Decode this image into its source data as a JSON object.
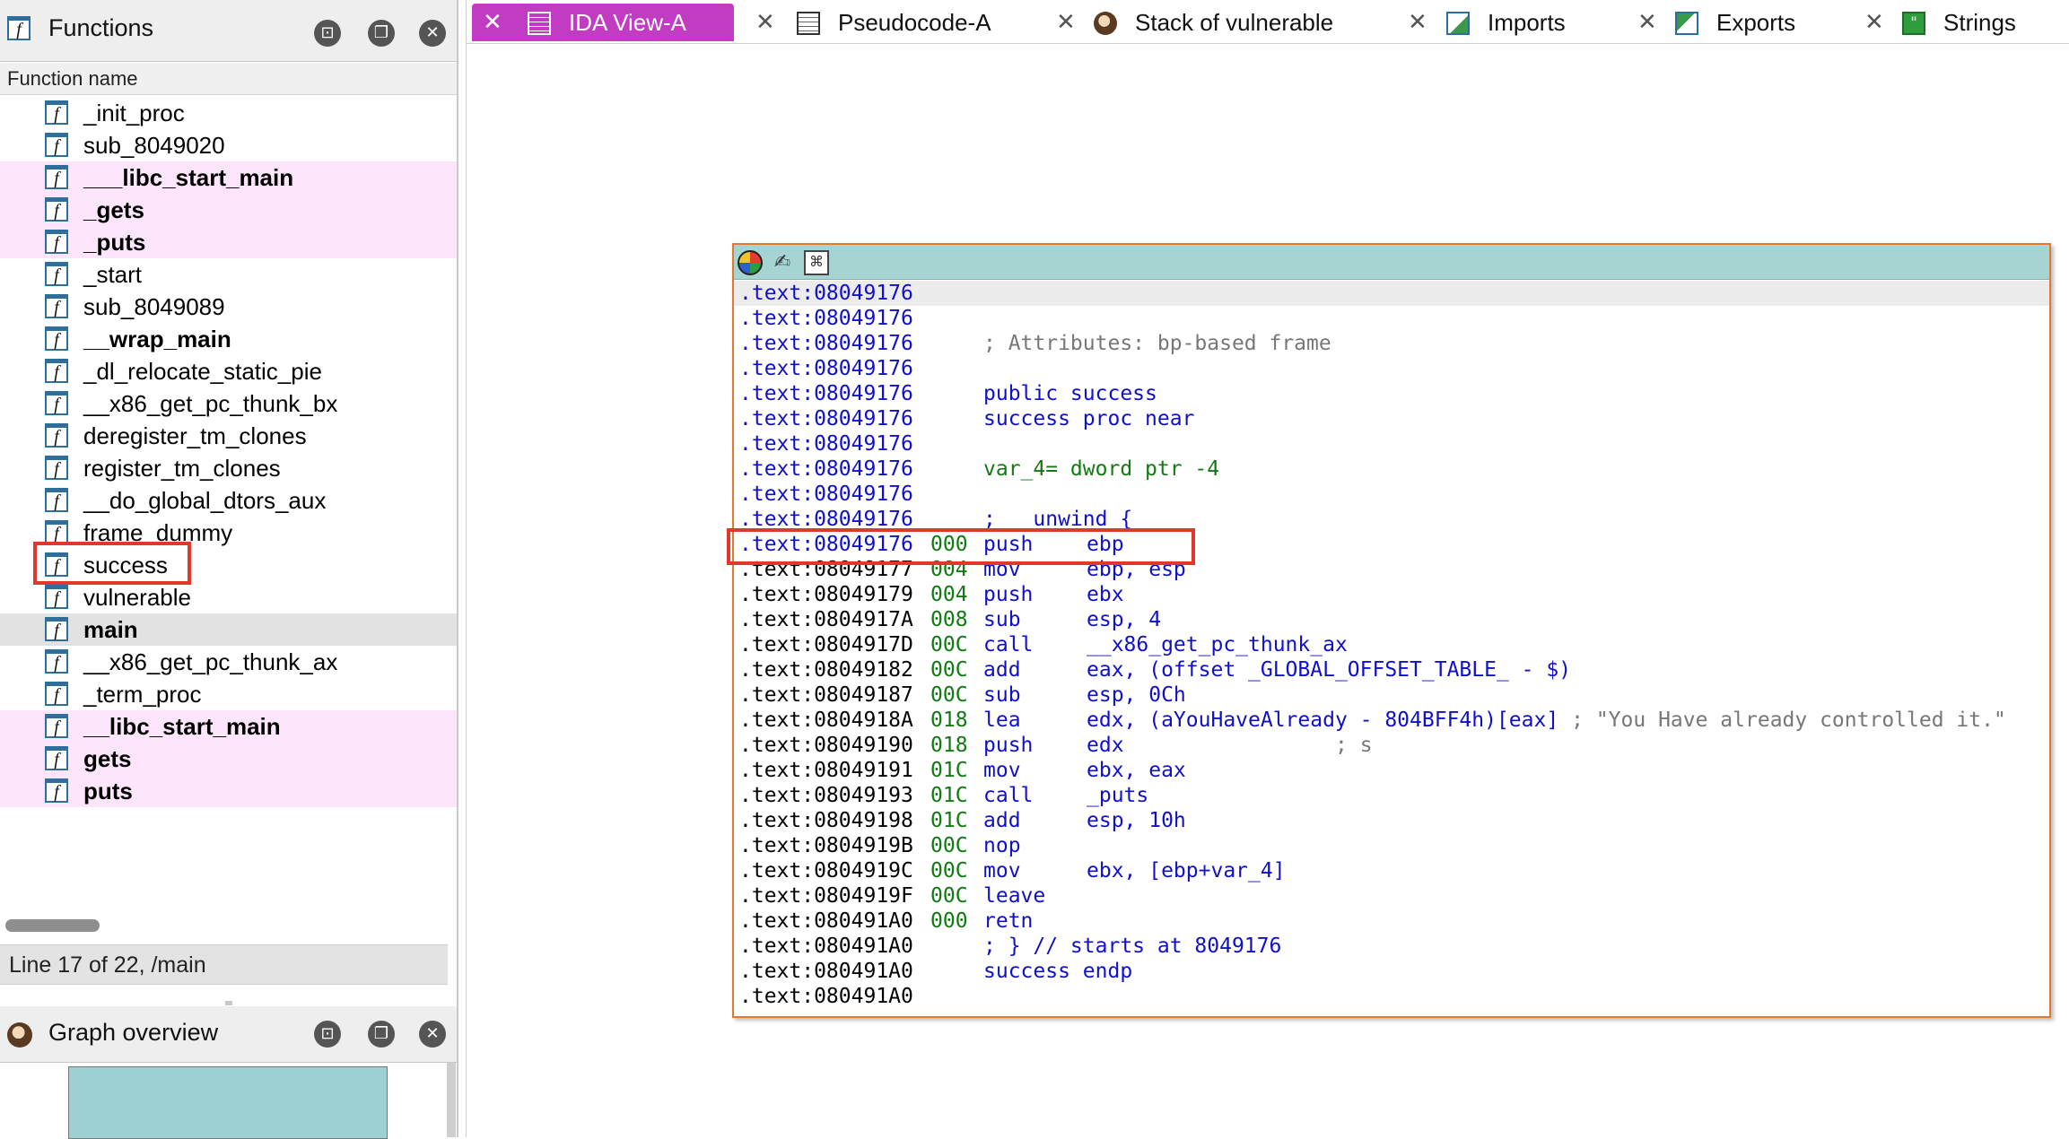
{
  "functions_panel": {
    "title": "Functions",
    "column_header": "Function name",
    "items": [
      {
        "name": "_init_proc",
        "lib": false,
        "bold": false,
        "selected": false
      },
      {
        "name": "sub_8049020",
        "lib": false,
        "bold": false,
        "selected": false
      },
      {
        "name": "___libc_start_main",
        "lib": true,
        "bold": true,
        "selected": false
      },
      {
        "name": "_gets",
        "lib": true,
        "bold": true,
        "selected": false
      },
      {
        "name": "_puts",
        "lib": true,
        "bold": true,
        "selected": false
      },
      {
        "name": "_start",
        "lib": false,
        "bold": false,
        "selected": false
      },
      {
        "name": "sub_8049089",
        "lib": false,
        "bold": false,
        "selected": false
      },
      {
        "name": "__wrap_main",
        "lib": false,
        "bold": true,
        "selected": false
      },
      {
        "name": "_dl_relocate_static_pie",
        "lib": false,
        "bold": false,
        "selected": false
      },
      {
        "name": "__x86_get_pc_thunk_bx",
        "lib": false,
        "bold": false,
        "selected": false
      },
      {
        "name": "deregister_tm_clones",
        "lib": false,
        "bold": false,
        "selected": false
      },
      {
        "name": "register_tm_clones",
        "lib": false,
        "bold": false,
        "selected": false
      },
      {
        "name": "__do_global_dtors_aux",
        "lib": false,
        "bold": false,
        "selected": false
      },
      {
        "name": "frame_dummy",
        "lib": false,
        "bold": false,
        "selected": false
      },
      {
        "name": "success",
        "lib": false,
        "bold": false,
        "selected": false
      },
      {
        "name": "vulnerable",
        "lib": false,
        "bold": false,
        "selected": false
      },
      {
        "name": "main",
        "lib": false,
        "bold": true,
        "selected": true
      },
      {
        "name": "__x86_get_pc_thunk_ax",
        "lib": false,
        "bold": false,
        "selected": false
      },
      {
        "name": "_term_proc",
        "lib": false,
        "bold": false,
        "selected": false
      },
      {
        "name": "__libc_start_main",
        "lib": true,
        "bold": true,
        "selected": false
      },
      {
        "name": "gets",
        "lib": true,
        "bold": true,
        "selected": false
      },
      {
        "name": "puts",
        "lib": true,
        "bold": true,
        "selected": false
      }
    ],
    "status": "Line 17 of 22, /main"
  },
  "graph_overview": {
    "title": "Graph overview"
  },
  "tabs": [
    {
      "label": "IDA View-A",
      "icon": "document-icon",
      "active": true
    },
    {
      "label": "Pseudocode-A",
      "icon": "document-icon",
      "active": false
    },
    {
      "label": "Stack of vulnerable",
      "icon": "avatar-icon",
      "active": false
    },
    {
      "label": "Imports",
      "icon": "imports-icon",
      "active": false
    },
    {
      "label": "Exports",
      "icon": "exports-icon",
      "active": false
    },
    {
      "label": "Strings",
      "icon": "strings-icon",
      "active": false
    }
  ],
  "code_view": {
    "lines": [
      {
        "addr": ".text:08049176",
        "addr_blue": true,
        "sp": "",
        "text": "",
        "text_style": ""
      },
      {
        "addr": ".text:08049176",
        "addr_blue": true,
        "sp": "",
        "text": "",
        "text_style": ""
      },
      {
        "addr": ".text:08049176",
        "addr_blue": true,
        "sp": "",
        "text": "; Attributes: bp-based frame",
        "text_style": "gray"
      },
      {
        "addr": ".text:08049176",
        "addr_blue": true,
        "sp": "",
        "text": "",
        "text_style": ""
      },
      {
        "addr": ".text:08049176",
        "addr_blue": true,
        "sp": "",
        "text": "public success",
        "text_style": "blue"
      },
      {
        "addr": ".text:08049176",
        "addr_blue": true,
        "sp": "",
        "text": "success proc near",
        "text_style": "blue"
      },
      {
        "addr": ".text:08049176",
        "addr_blue": true,
        "sp": "",
        "text": "",
        "text_style": ""
      },
      {
        "addr": ".text:08049176",
        "addr_blue": true,
        "sp": "",
        "text": "var_4= dword ptr -4",
        "text_style": "green"
      },
      {
        "addr": ".text:08049176",
        "addr_blue": true,
        "sp": "",
        "text": "",
        "text_style": ""
      },
      {
        "addr": ".text:08049176",
        "addr_blue": true,
        "sp": "",
        "text": "; __unwind {",
        "text_style": "blue"
      },
      {
        "addr": ".text:08049176",
        "addr_blue": true,
        "sp": "000",
        "mnemonic": "push",
        "operand": "ebp"
      },
      {
        "addr": ".text:08049177",
        "addr_blue": false,
        "sp": "004",
        "mnemonic": "mov",
        "operand": "ebp, esp"
      },
      {
        "addr": ".text:08049179",
        "addr_blue": false,
        "sp": "004",
        "mnemonic": "push",
        "operand": "ebx"
      },
      {
        "addr": ".text:0804917A",
        "addr_blue": false,
        "sp": "008",
        "mnemonic": "sub",
        "operand": "esp, 4"
      },
      {
        "addr": ".text:0804917D",
        "addr_blue": false,
        "sp": "00C",
        "mnemonic": "call",
        "operand": "__x86_get_pc_thunk_ax"
      },
      {
        "addr": ".text:08049182",
        "addr_blue": false,
        "sp": "00C",
        "mnemonic": "add",
        "operand": "eax, (offset _GLOBAL_OFFSET_TABLE_ - $)"
      },
      {
        "addr": ".text:08049187",
        "addr_blue": false,
        "sp": "00C",
        "mnemonic": "sub",
        "operand": "esp, 0Ch"
      },
      {
        "addr": ".text:0804918A",
        "addr_blue": false,
        "sp": "018",
        "mnemonic": "lea",
        "operand": "edx, (aYouHaveAlready - 804BFF4h)[eax]",
        "comment": "; \"You Have already controlled it.\""
      },
      {
        "addr": ".text:08049190",
        "addr_blue": false,
        "sp": "018",
        "mnemonic": "push",
        "operand": "edx",
        "comment": "; s"
      },
      {
        "addr": ".text:08049191",
        "addr_blue": false,
        "sp": "01C",
        "mnemonic": "mov",
        "operand": "ebx, eax"
      },
      {
        "addr": ".text:08049193",
        "addr_blue": false,
        "sp": "01C",
        "mnemonic": "call",
        "operand": "_puts"
      },
      {
        "addr": ".text:08049198",
        "addr_blue": false,
        "sp": "01C",
        "mnemonic": "add",
        "operand": "esp, 10h"
      },
      {
        "addr": ".text:0804919B",
        "addr_blue": false,
        "sp": "00C",
        "mnemonic": "nop",
        "operand": ""
      },
      {
        "addr": ".text:0804919C",
        "addr_blue": false,
        "sp": "00C",
        "mnemonic": "mov",
        "operand": "ebx, [ebp+var_4]"
      },
      {
        "addr": ".text:0804919F",
        "addr_blue": false,
        "sp": "00C",
        "mnemonic": "leave",
        "operand": ""
      },
      {
        "addr": ".text:080491A0",
        "addr_blue": false,
        "sp": "000",
        "mnemonic": "retn",
        "operand": ""
      },
      {
        "addr": ".text:080491A0",
        "addr_blue": false,
        "sp": "",
        "text": "; } // starts at 8049176",
        "text_style": "blue"
      },
      {
        "addr": ".text:080491A0",
        "addr_blue": false,
        "sp": "",
        "text": "success endp",
        "text_style": "blue"
      },
      {
        "addr": ".text:080491A0",
        "addr_blue": false,
        "sp": "",
        "text": "",
        "text_style": ""
      }
    ]
  },
  "colors": {
    "active_tab": "#c23cc3",
    "library_function_bg": "#fde6fb",
    "code_window_border": "#e07a2e",
    "code_toolbar": "#a6d4d2",
    "highlight_box": "#e0392b",
    "address_blue": "#1010c8",
    "stack_pointer_green": "#137a13"
  }
}
